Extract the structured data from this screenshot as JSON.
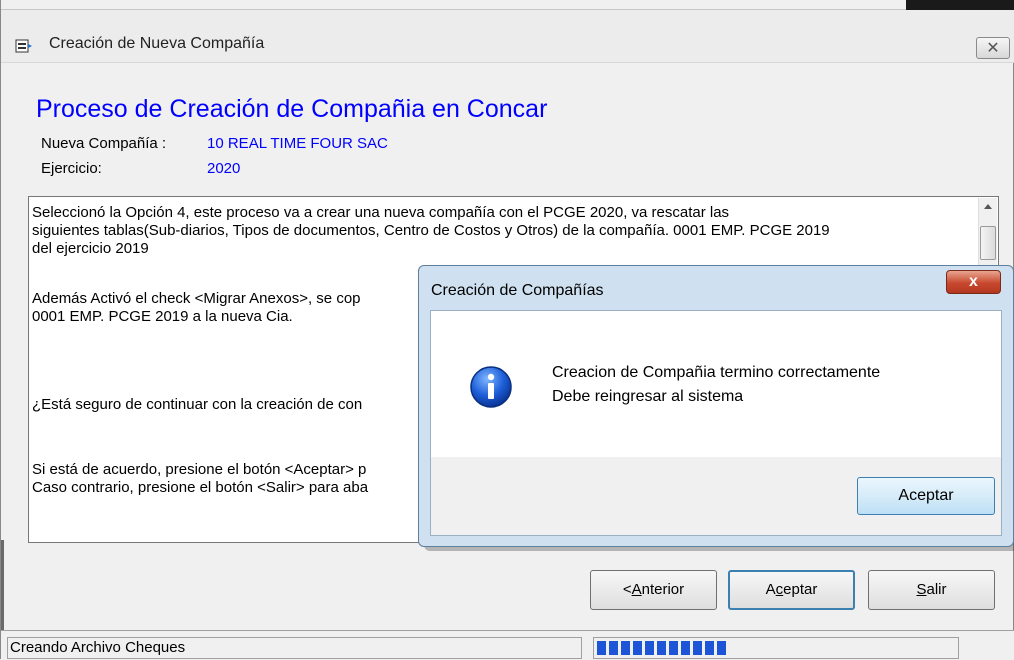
{
  "window": {
    "title": "Creación de Nueva Compañía",
    "close_label": "✕"
  },
  "header": {
    "heading": "Proceso de Creación de Compañia en Concar",
    "company_label": "Nueva Compañía :",
    "company_value": "10 REAL TIME FOUR SAC",
    "year_label": "Ejercicio:",
    "year_value": "2020"
  },
  "message_panel": {
    "line1": "Seleccionó la Opción 4, este proceso va a crear una nueva compañía con el PCGE 2020, va rescatar las",
    "line2": "siguientes tablas(Sub-diarios, Tipos de documentos, Centro de Costos y Otros) de la compañía. 0001 EMP. PCGE 2019",
    "line3": "del ejercicio 2019",
    "line4": "Además Activó el check <Migrar Anexos>, se cop",
    "line5": "0001 EMP. PCGE 2019 a la nueva Cia.",
    "line6": "¿Está seguro de continuar con la creación de con",
    "line7": "Si está de acuerdo, presione el botón <Aceptar> p",
    "line8": "Caso contrario, presione el botón <Salir> para aba"
  },
  "buttons": {
    "back_prefix": "<",
    "back_mnemonic": "A",
    "back_rest": "nterior",
    "accept_prefix": "A",
    "accept_mnemonic": "c",
    "accept_rest": "eptar",
    "exit_mnemonic": "S",
    "exit_rest": "alir"
  },
  "status_bar": {
    "text": "Creando Archivo Cheques",
    "progress_fraction": 0.36
  },
  "dialog": {
    "title": "Creación de Compañías",
    "close_label": "x",
    "message_line1": "Creacion de Compañia termino correctamente",
    "message_line2": "Debe reingresar al sistema",
    "ok_label": "Aceptar",
    "icon": "info-icon"
  }
}
